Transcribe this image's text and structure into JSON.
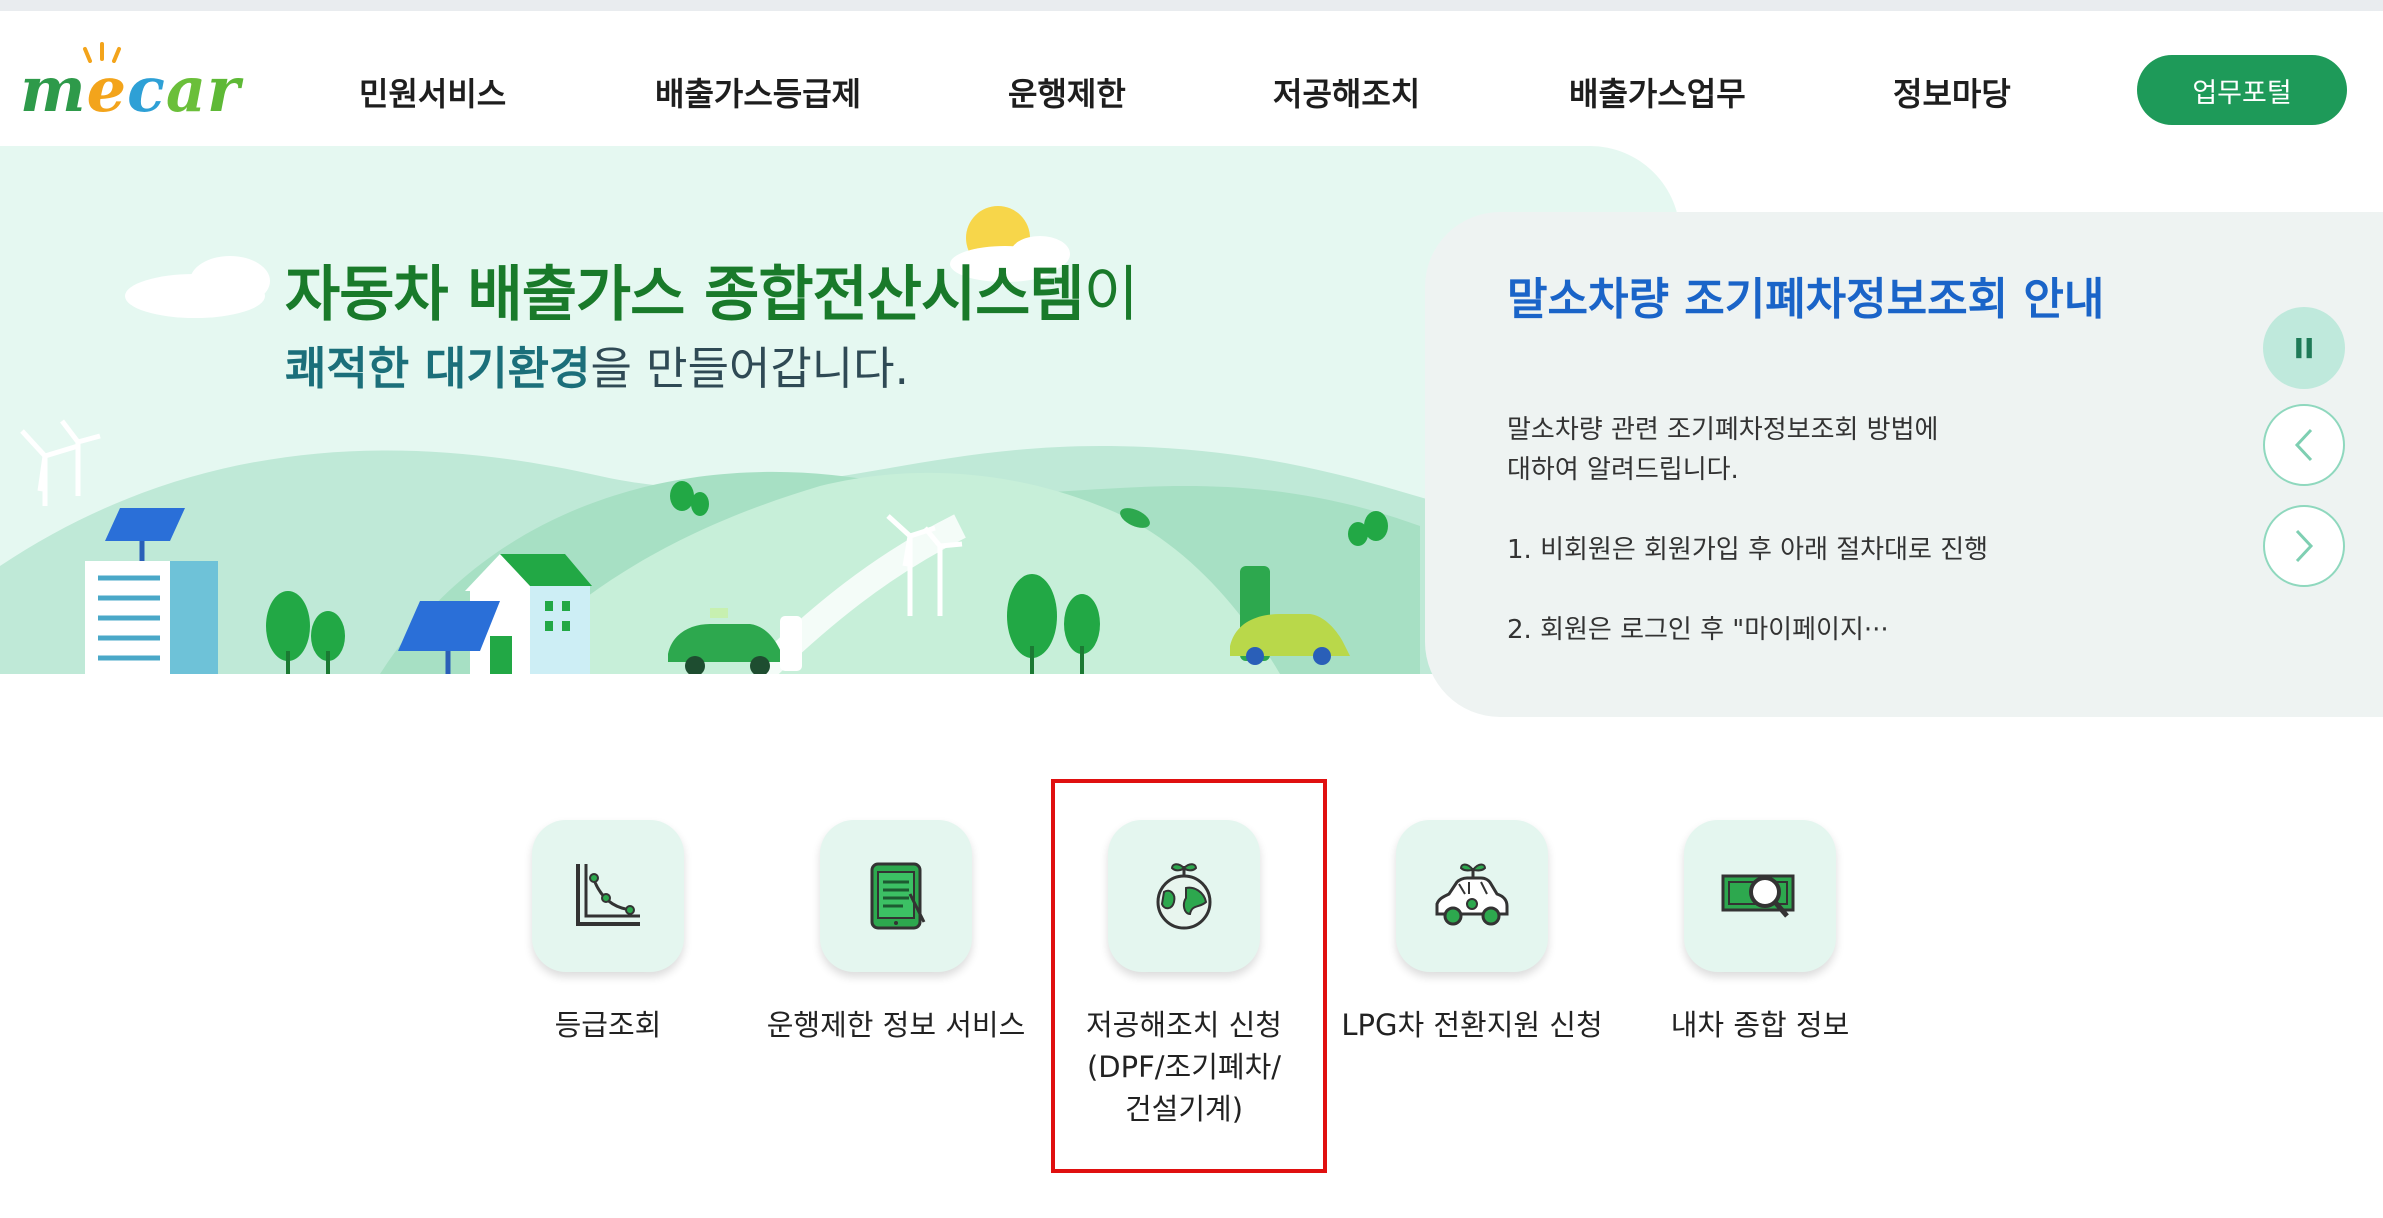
{
  "header": {
    "logo_text": {
      "m": "m",
      "e": "e",
      "c": "c",
      "a": "a",
      "r": "r"
    },
    "nav": [
      "민원서비스",
      "배출가스등급제",
      "운행제한",
      "저공해조치",
      "배출가스업무",
      "정보마당"
    ],
    "portal_button": "업무포털"
  },
  "hero": {
    "title_bold": "자동차 배출가스 종합전산시스템",
    "title_suffix": "이",
    "sub_bold": "쾌적한 대기환경",
    "sub_rest": "을 만들어갑니다."
  },
  "notice": {
    "title": "말소차량 조기폐차정보조회 안내",
    "line1": "말소차량 관련 조기폐차정보조회 방법에",
    "line2": "대하여 알려드립니다.",
    "line3": "1. 비회원은 회원가입 후 아래 절차대로 진행",
    "line4": "2. 회원은 로그인 후 \"마이페이지···",
    "pause_symbol": "II"
  },
  "quick_menu": [
    {
      "label": "등급조회",
      "icon": "chart-icon"
    },
    {
      "label": "운행제한 정보 서비스",
      "icon": "tablet-icon"
    },
    {
      "label": "저공해조치 신청\n(DPF/조기폐차/\n건설기계)",
      "icon": "earth-sprout-icon"
    },
    {
      "label": "LPG차 전환지원 신청",
      "icon": "eco-car-icon"
    },
    {
      "label": "내차 종합 정보",
      "icon": "money-search-icon"
    }
  ],
  "colors": {
    "accent_green": "#1e9a59",
    "hero_bg": "#e5f8f1",
    "notice_title": "#1a64c8",
    "highlight_red": "#e01010"
  }
}
